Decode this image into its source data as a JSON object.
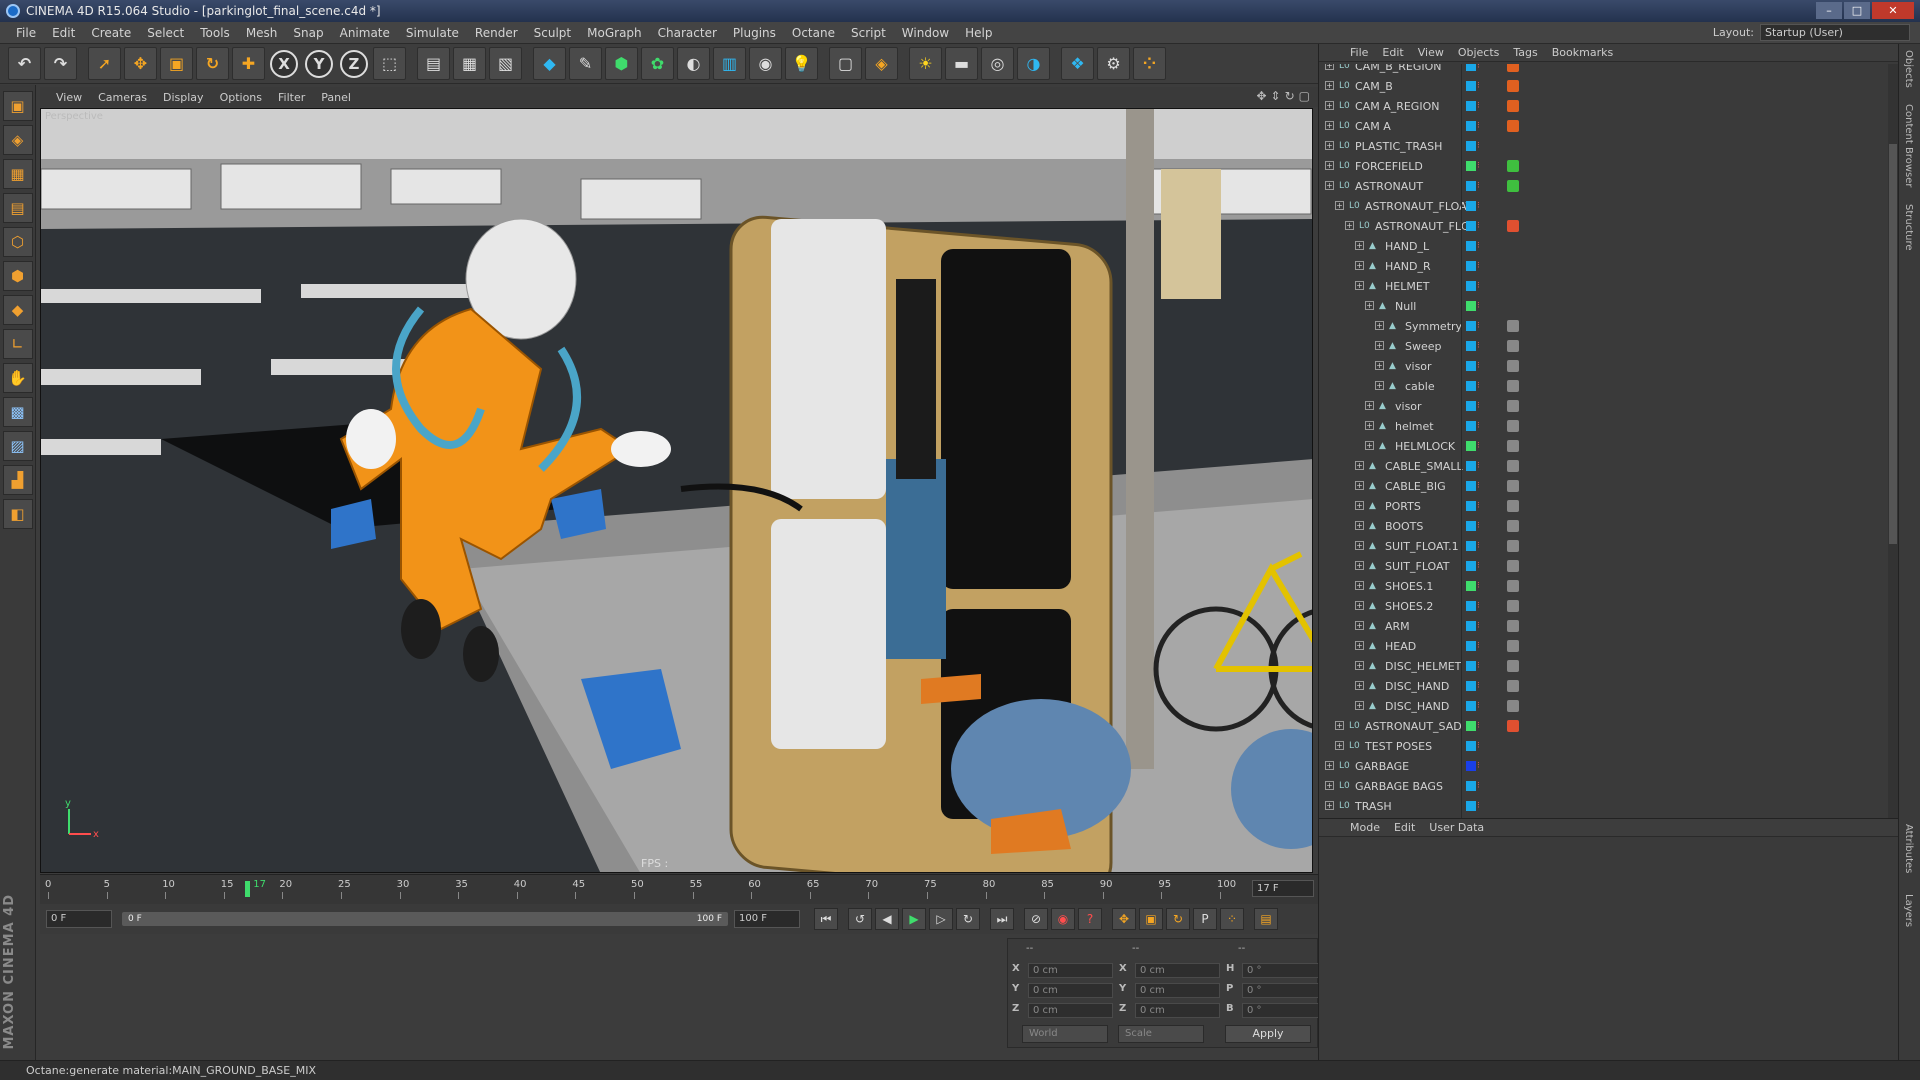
{
  "window": {
    "title": "CINEMA 4D R15.064 Studio - [parkinglot_final_scene.c4d *]"
  },
  "menu": [
    "File",
    "Edit",
    "Create",
    "Select",
    "Tools",
    "Mesh",
    "Snap",
    "Animate",
    "Simulate",
    "Render",
    "Sculpt",
    "MoGraph",
    "Character",
    "Plugins",
    "Octane",
    "Script",
    "Window",
    "Help"
  ],
  "layout": {
    "label": "Layout:",
    "value": "Startup (User)"
  },
  "viewport_menu": [
    "View",
    "Cameras",
    "Display",
    "Options",
    "Filter",
    "Panel"
  ],
  "viewport": {
    "label": "Perspective",
    "fps": "FPS :"
  },
  "timeline": {
    "ticks": [
      "0",
      "5",
      "10",
      "15",
      "20",
      "25",
      "30",
      "35",
      "40",
      "45",
      "50",
      "55",
      "60",
      "65",
      "70",
      "75",
      "80",
      "85",
      "90",
      "95",
      "100"
    ],
    "current": "17",
    "current_field": "17 F",
    "start_field": "0 F",
    "slider_start": "0 F",
    "slider_end": "100 F",
    "end_field": "100 F"
  },
  "coords": {
    "header": [
      "--",
      "--",
      "--"
    ],
    "rows": [
      {
        "a": "X",
        "av": "0 cm",
        "b": "X",
        "bv": "0 cm",
        "c": "H",
        "cv": "0 °"
      },
      {
        "a": "Y",
        "av": "0 cm",
        "b": "Y",
        "bv": "0 cm",
        "c": "P",
        "cv": "0 °"
      },
      {
        "a": "Z",
        "av": "0 cm",
        "b": "Z",
        "bv": "0 cm",
        "c": "B",
        "cv": "0 °"
      }
    ],
    "world": "World",
    "scale": "Scale",
    "apply": "Apply"
  },
  "object_manager": {
    "menu": [
      "File",
      "Edit",
      "View",
      "Objects",
      "Tags",
      "Bookmarks"
    ],
    "items": [
      {
        "label": "CAM_B_REGION",
        "depth": 0
      },
      {
        "label": "CAM_B",
        "depth": 0
      },
      {
        "label": "CAM A_REGION",
        "depth": 0
      },
      {
        "label": "CAM A",
        "depth": 0
      },
      {
        "label": "PLASTIC_TRASH",
        "depth": 0
      },
      {
        "label": "FORCEFIELD",
        "depth": 0
      },
      {
        "label": "ASTRONAUT",
        "depth": 0
      },
      {
        "label": "ASTRONAUT_FLOAT",
        "depth": 1
      },
      {
        "label": "ASTRONAUT_FLC",
        "depth": 2
      },
      {
        "label": "HAND_L",
        "depth": 3
      },
      {
        "label": "HAND_R",
        "depth": 3
      },
      {
        "label": "HELMET",
        "depth": 3
      },
      {
        "label": "Null",
        "depth": 4
      },
      {
        "label": "Symmetry",
        "depth": 5
      },
      {
        "label": "Sweep",
        "depth": 5
      },
      {
        "label": "visor",
        "depth": 5
      },
      {
        "label": "cable",
        "depth": 5
      },
      {
        "label": "visor",
        "depth": 4
      },
      {
        "label": "helmet",
        "depth": 4
      },
      {
        "label": "HELMLOCK",
        "depth": 4
      },
      {
        "label": "CABLE_SMALL",
        "depth": 3
      },
      {
        "label": "CABLE_BIG",
        "depth": 3
      },
      {
        "label": "PORTS",
        "depth": 3
      },
      {
        "label": "BOOTS",
        "depth": 3
      },
      {
        "label": "SUIT_FLOAT.1",
        "depth": 3
      },
      {
        "label": "SUIT_FLOAT",
        "depth": 3
      },
      {
        "label": "SHOES.1",
        "depth": 3
      },
      {
        "label": "SHOES.2",
        "depth": 3
      },
      {
        "label": "ARM",
        "depth": 3
      },
      {
        "label": "HEAD",
        "depth": 3
      },
      {
        "label": "DISC_HELMET",
        "depth": 3
      },
      {
        "label": "DISC_HAND",
        "depth": 3
      },
      {
        "label": "DISC_HAND",
        "depth": 3
      },
      {
        "label": "ASTRONAUT_SAD",
        "depth": 1
      },
      {
        "label": "TEST POSES",
        "depth": 1
      },
      {
        "label": "GARBAGE",
        "depth": 0
      },
      {
        "label": "GARBAGE BAGS",
        "depth": 0
      },
      {
        "label": "TRASH",
        "depth": 0
      }
    ]
  },
  "attributes": {
    "menu": [
      "Mode",
      "Edit",
      "User Data"
    ]
  },
  "side_tabs": [
    "Objects",
    "Content Browser",
    "Structure"
  ],
  "side_tabs_bottom": [
    "Attributes",
    "Layers"
  ],
  "branding": "MAXON CINEMA 4D",
  "status": "Octane:generate material:MAIN_GROUND_BASE_MIX",
  "colors": {
    "accent_orange": "#f5a623",
    "playhead_green": "#3fdc6c",
    "tag_cyan": "#1aa7e8"
  },
  "icons": [
    "undo-icon",
    "move-icon",
    "scale-icon",
    "rotate-icon",
    "x-axis-icon",
    "y-axis-icon",
    "z-axis-icon",
    "render-icon",
    "cube-icon",
    "light-icon",
    "camera-icon",
    "sun-icon",
    "settings-icon"
  ]
}
